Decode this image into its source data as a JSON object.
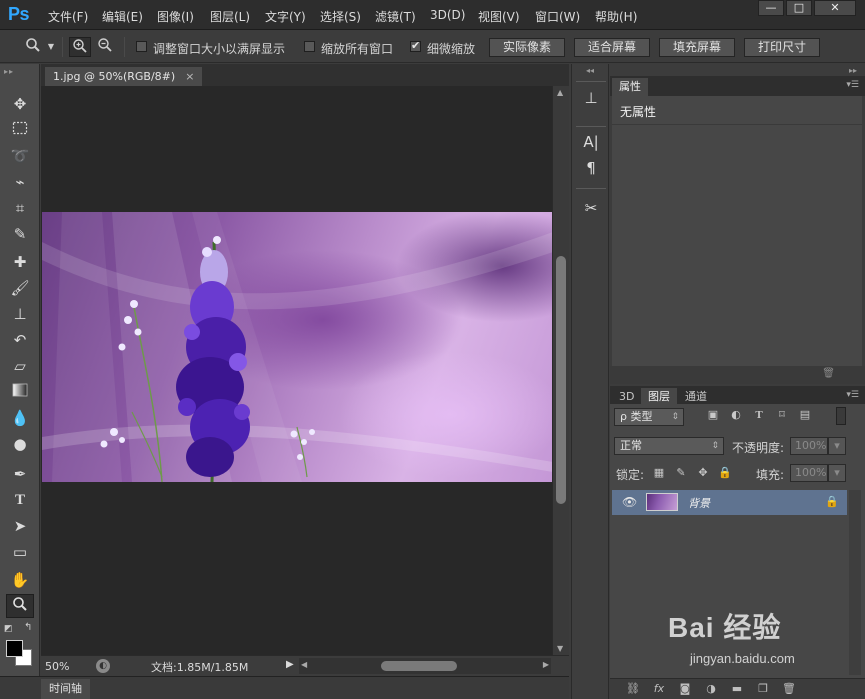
{
  "app": {
    "logo": "Ps"
  },
  "menubar": {
    "items": [
      "文件(F)",
      "编辑(E)",
      "图像(I)",
      "图层(L)",
      "文字(Y)",
      "选择(S)",
      "滤镜(T)",
      "3D(D)",
      "视图(V)",
      "窗口(W)",
      "帮助(H)"
    ],
    "window_buttons": [
      "—",
      "□",
      "✕"
    ]
  },
  "options": {
    "checkbox_resize": {
      "label": "调整窗口大小以满屏显示",
      "checked": false
    },
    "checkbox_zoom_all": {
      "label": "缩放所有窗口",
      "checked": false
    },
    "checkbox_scrubby": {
      "label": "细微缩放",
      "checked": true
    },
    "buttons": [
      "实际像素",
      "适合屏幕",
      "填充屏幕",
      "打印尺寸"
    ]
  },
  "document": {
    "tab_title": "1.jpg @ 50%(RGB/8#)",
    "close": "×"
  },
  "status": {
    "zoom": "50%",
    "doc_info": "文档:1.85M/1.85M"
  },
  "timeline": {
    "label": "时间轴"
  },
  "properties": {
    "tab": "属性",
    "title": "无属性"
  },
  "layers": {
    "tabs": [
      "3D",
      "图层",
      "通道"
    ],
    "active_tab": "图层",
    "filter_kind": "ρ 类型",
    "blend_mode": "正常",
    "opacity_label": "不透明度:",
    "opacity_value": "100%",
    "lock_label": "锁定:",
    "fill_label": "填充:",
    "fill_value": "100%",
    "layer_name": "背景"
  },
  "watermark": {
    "main": "Bai 经验",
    "sub": "jingyan.baidu.com"
  },
  "colors": {
    "foreground": "#000000",
    "background": "#ffffff",
    "selected_layer": "#5f7390",
    "ps_blue": "#31a8ff"
  }
}
